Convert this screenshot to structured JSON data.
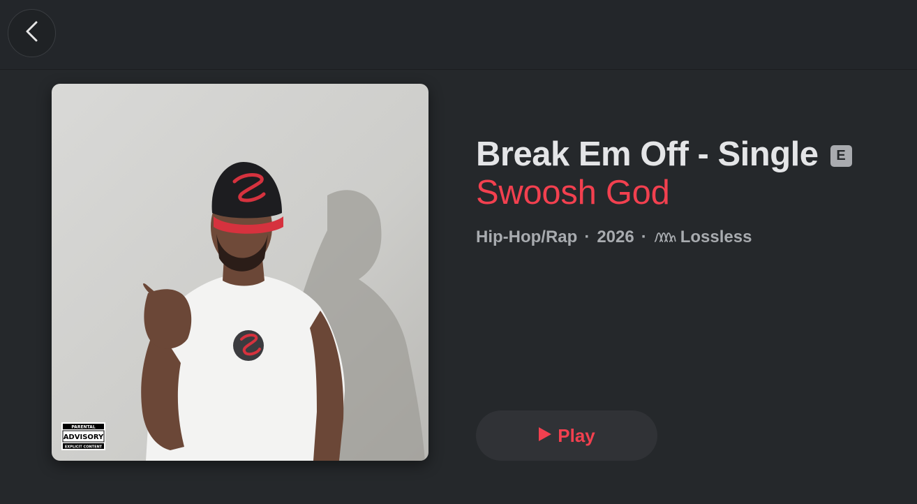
{
  "nav": {
    "back_label": "Back"
  },
  "album": {
    "title": "Break Em Off - Single",
    "explicit_badge": "E",
    "artist": "Swoosh God",
    "genre": "Hip-Hop/Rap",
    "year": "2026",
    "quality": "Lossless",
    "separator": "·",
    "advisory": {
      "line1": "PARENTAL",
      "line2": "ADVISORY",
      "line3": "EXPLICIT CONTENT"
    }
  },
  "actions": {
    "play_label": "Play"
  },
  "colors": {
    "accent": "#f2404f",
    "background": "#25282b",
    "topbar": "#23262a",
    "button_bg": "#303236"
  },
  "icons": {
    "back": "chevron-left-icon",
    "lossless": "lossless-wave-icon",
    "play": "play-icon"
  }
}
